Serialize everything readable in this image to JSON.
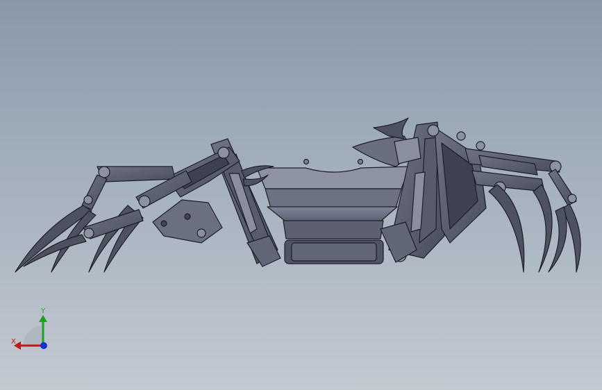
{
  "window": {
    "title": ""
  },
  "viewport": {
    "model": "robotic-crab-assembly",
    "background_top": "#8898a9",
    "background_bottom": "#c2c9d1",
    "model_fill": "#5f6473",
    "model_fill_light": "#74798a",
    "model_edge": "#1c1e26"
  },
  "triad": {
    "x_label": "X",
    "y_label": "Y",
    "x_color": "#c01818",
    "y_color": "#20a020",
    "z_color": "#1830d0"
  }
}
